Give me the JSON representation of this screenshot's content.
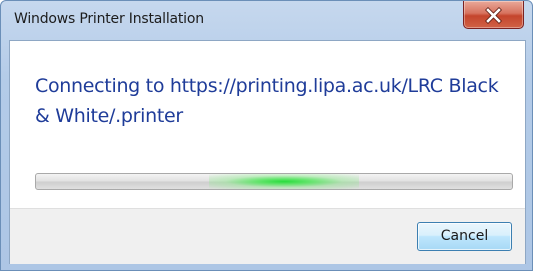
{
  "window": {
    "title": "Windows Printer Installation"
  },
  "titlebar": {
    "close_icon": "close-x-icon"
  },
  "message": {
    "text": "Connecting to https://printing.lipa.ac.uk/LRC Black & White/.printer"
  },
  "progress": {
    "mode": "indeterminate",
    "glow_position": 0.52,
    "glow_color": "#28dc3c"
  },
  "footer": {
    "cancel_label": "Cancel"
  },
  "colors": {
    "message_text": "#1f3c99",
    "frame": "#b3cbe8",
    "close_button": "#c4452c",
    "button_border": "#3c7fb1"
  }
}
